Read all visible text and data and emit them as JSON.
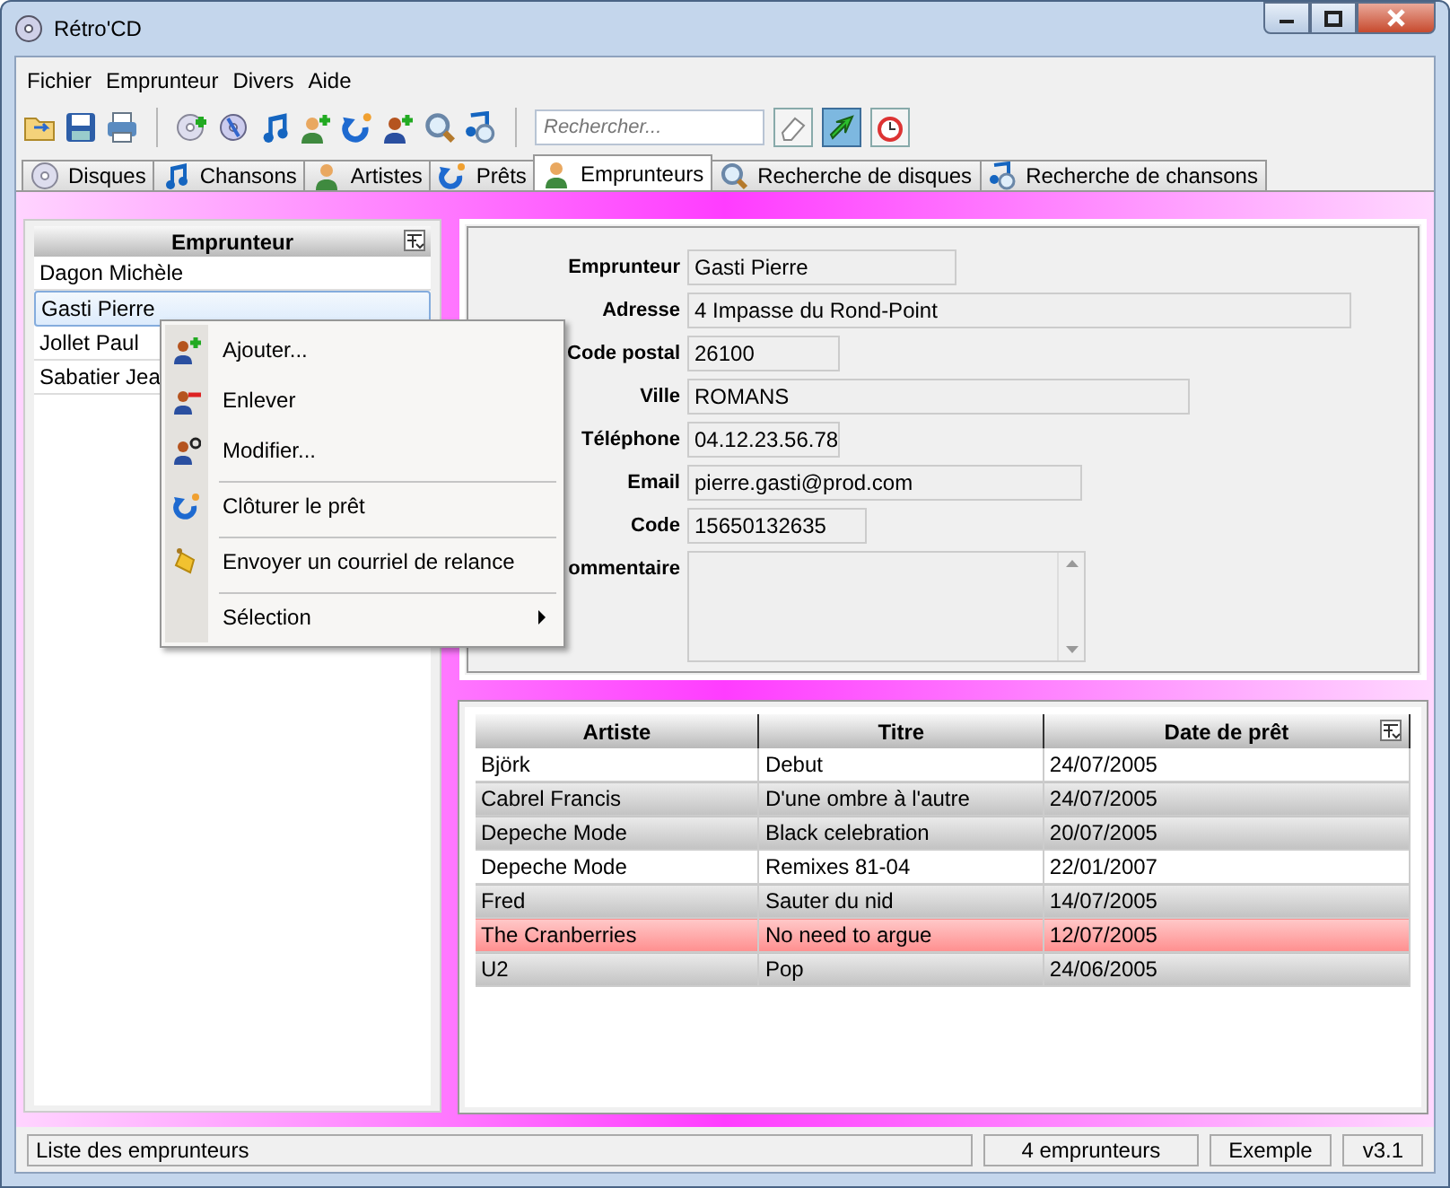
{
  "window": {
    "title": "Rétro'CD"
  },
  "menu": [
    "Fichier",
    "Emprunteur",
    "Divers",
    "Aide"
  ],
  "search": {
    "placeholder": "Rechercher..."
  },
  "tabs": [
    {
      "label": "Disques",
      "selected": false
    },
    {
      "label": "Chansons",
      "selected": false
    },
    {
      "label": "Artistes",
      "selected": false
    },
    {
      "label": "Prêts",
      "selected": false
    },
    {
      "label": "Emprunteurs",
      "selected": true
    },
    {
      "label": "Recherche de disques",
      "selected": false
    },
    {
      "label": "Recherche de chansons",
      "selected": false
    }
  ],
  "borrower_list": {
    "header": "Emprunteur",
    "items": [
      {
        "name": "Dagon Michèle",
        "selected": false
      },
      {
        "name": "Gasti Pierre",
        "selected": true
      },
      {
        "name": "Jollet Paul",
        "selected": false
      },
      {
        "name": "Sabatier Jea",
        "selected": false
      }
    ]
  },
  "context_menu": [
    {
      "label": "Ajouter...",
      "separator_before": false,
      "submenu": false
    },
    {
      "label": "Enlever",
      "separator_before": false,
      "submenu": false
    },
    {
      "label": "Modifier...",
      "separator_before": false,
      "submenu": false
    },
    {
      "label": "Clôturer le prêt",
      "separator_before": true,
      "submenu": false
    },
    {
      "label": "Envoyer un courriel de relance",
      "separator_before": true,
      "submenu": false
    },
    {
      "label": "Sélection",
      "separator_before": true,
      "submenu": true
    }
  ],
  "details": [
    {
      "label": "Emprunteur",
      "value": "Gasti Pierre",
      "kind": "text"
    },
    {
      "label": "Adresse",
      "value": "4 Impasse du Rond-Point",
      "kind": "text"
    },
    {
      "label": "Code postal",
      "value": "26100",
      "kind": "text"
    },
    {
      "label": "Ville",
      "value": "ROMANS",
      "kind": "text"
    },
    {
      "label": "Téléphone",
      "value": "04.12.23.56.78",
      "kind": "text"
    },
    {
      "label": "Email",
      "value": "pierre.gasti@prod.com",
      "kind": "text"
    },
    {
      "label": "Code",
      "value": "15650132635",
      "kind": "text"
    },
    {
      "label": "ommentaire",
      "kind": "multiline"
    }
  ],
  "loans": {
    "columns": [
      "Artiste",
      "Titre",
      "Date de prêt"
    ],
    "rows": [
      {
        "cells": [
          "Björk",
          "Debut",
          "24/07/2005"
        ],
        "kind": "plain"
      },
      {
        "cells": [
          "Cabrel Francis",
          "D'une ombre à l'autre",
          "24/07/2005"
        ],
        "kind": "shaded"
      },
      {
        "cells": [
          "Depeche Mode",
          "Black celebration",
          "20/07/2005"
        ],
        "kind": "shaded"
      },
      {
        "cells": [
          "Depeche Mode",
          "Remixes 81-04",
          "22/01/2007"
        ],
        "kind": "plain"
      },
      {
        "cells": [
          "Fred",
          "Sauter du nid",
          "14/07/2005"
        ],
        "kind": "shaded"
      },
      {
        "cells": [
          "The Cranberries",
          "No need to argue",
          "12/07/2005"
        ],
        "kind": "late"
      },
      {
        "cells": [
          "U2",
          "Pop",
          "24/06/2005"
        ],
        "kind": "shaded"
      }
    ]
  },
  "status_bar": [
    "Liste des emprunteurs",
    "4 emprunteurs",
    "Exemple",
    "v3.1"
  ]
}
